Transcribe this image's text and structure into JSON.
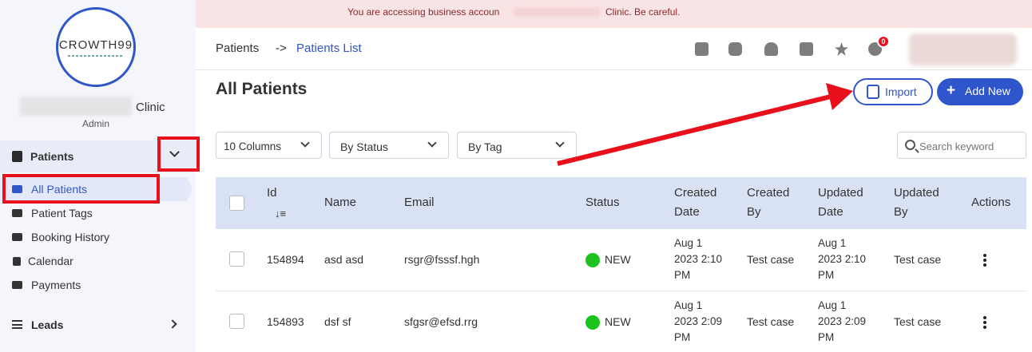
{
  "banner": {
    "text_before": "You are accessing business accoun",
    "text_after": "Clinic. Be careful."
  },
  "sidebar": {
    "logo_text": "CROWTH99",
    "clinic_name": "Clinic",
    "role": "Admin",
    "group": {
      "label": "Patients",
      "icon": "calendar-check-icon"
    },
    "items": [
      {
        "label": "All Patients",
        "icon": "bed-icon",
        "active": true
      },
      {
        "label": "Patient Tags",
        "icon": "tags-icon",
        "active": false
      },
      {
        "label": "Booking History",
        "icon": "id-card-icon",
        "active": false
      },
      {
        "label": "Calendar",
        "icon": "calendar-icon",
        "active": false
      },
      {
        "label": "Payments",
        "icon": "money-icon",
        "active": false
      }
    ],
    "leads": {
      "label": "Leads",
      "icon": "list-icon"
    }
  },
  "header": {
    "breadcrumb_root": "Patients",
    "breadcrumb_sep": "->",
    "breadcrumb_current": "Patients List",
    "icons": [
      "calendar-check-icon",
      "robot-icon",
      "user-doctor-icon",
      "edit-icon",
      "star-icon",
      "chat-icon"
    ],
    "notification_count": "0"
  },
  "page": {
    "title": "All Patients",
    "import_label": "Import",
    "add_new_label": "Add New",
    "add_new_plus": "+"
  },
  "filters": {
    "columns": "10 Columns",
    "status": "By Status",
    "tag": "By Tag",
    "search_placeholder": "Search keyword"
  },
  "table": {
    "headers": {
      "id": "Id",
      "sort_icon": "↓≡",
      "name": "Name",
      "email": "Email",
      "status": "Status",
      "created_date": [
        "Created",
        "Date"
      ],
      "created_by": [
        "Created",
        "By"
      ],
      "updated_date": [
        "Updated",
        "Date"
      ],
      "updated_by": [
        "Updated",
        "By"
      ],
      "actions": "Actions"
    },
    "rows": [
      {
        "id": "154894",
        "name": "asd asd",
        "email": "rsgr@fsssf.hgh",
        "status": "NEW",
        "created": [
          "Aug 1",
          "2023 2:10",
          "PM"
        ],
        "created_by": "Test case",
        "updated": [
          "Aug 1",
          "2023 2:10",
          "PM"
        ],
        "updated_by": "Test case"
      },
      {
        "id": "154893",
        "name": "dsf sf",
        "email": "sfgsr@efsd.rrg",
        "status": "NEW",
        "created": [
          "Aug 1",
          "2023 2:09",
          "PM"
        ],
        "created_by": "Test case",
        "updated": [
          "Aug 1",
          "2023 2:09",
          "PM"
        ],
        "updated_by": "Test case"
      }
    ]
  },
  "colors": {
    "accent": "#3056c9",
    "annotation_red": "#e8101a",
    "status_new": "#1cc31c",
    "banner_bg": "#f9e4e5"
  }
}
